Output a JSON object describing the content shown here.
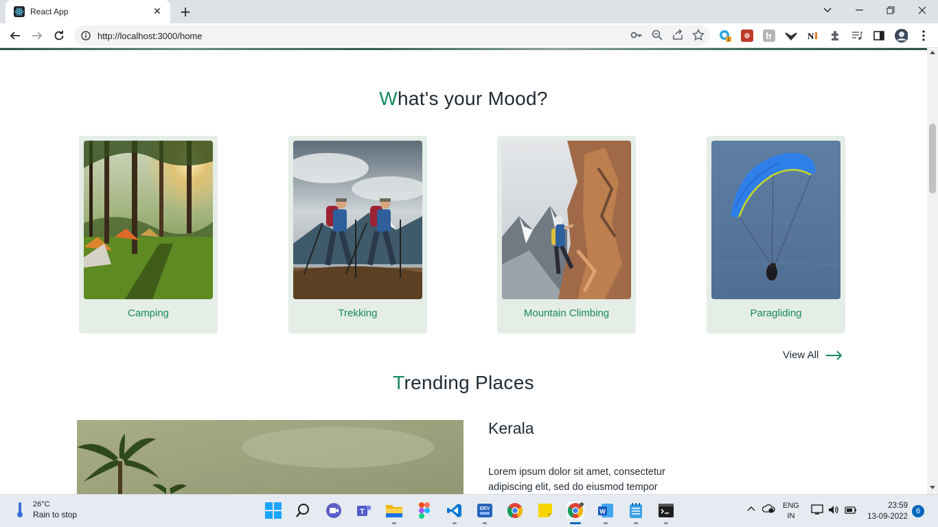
{
  "browser": {
    "tab_title": "React App",
    "url": "http://localhost:3000/home"
  },
  "page": {
    "mood_title_first": "W",
    "mood_title_rest": "hat's your Mood?",
    "cards": [
      {
        "label": "Camping"
      },
      {
        "label": "Trekking"
      },
      {
        "label": "Mountain Climbing"
      },
      {
        "label": "Paragliding"
      }
    ],
    "view_all": "View All",
    "trending_title_first": "T",
    "trending_title_rest": "rending Places",
    "place": {
      "name": "Kerala",
      "description": "Lorem ipsum dolor sit amet, consectetur adipiscing elit, sed do eiusmod tempor"
    },
    "accent_color": "#168a5c"
  },
  "taskbar": {
    "temperature": "26°C",
    "weather_text": "Rain to stop",
    "language": "ENG",
    "region": "IN",
    "time": "23:59",
    "date": "13-09-2022",
    "notification_count": "6",
    "extension_badge": "1"
  }
}
